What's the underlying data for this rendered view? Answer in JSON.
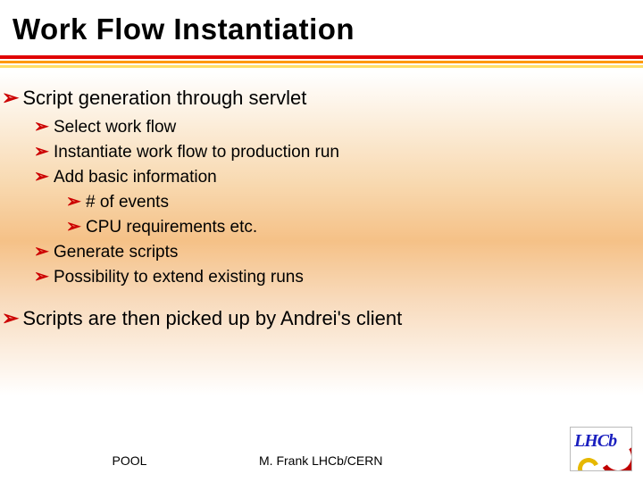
{
  "title": "Work Flow Instantiation",
  "bullets": {
    "b1": "Script generation through servlet",
    "b1_1": "Select work flow",
    "b1_2": "Instantiate work flow to production run",
    "b1_3": "Add basic information",
    "b1_3_1": "# of events",
    "b1_3_2": "CPU requirements etc.",
    "b1_4": "Generate scripts",
    "b1_5": "Possibility to extend existing runs",
    "b2": "Scripts are then picked up by Andrei's client"
  },
  "footer": {
    "left": "POOL",
    "mid": "M. Frank LHCb/CERN"
  },
  "logo": {
    "text": "LHCb"
  }
}
